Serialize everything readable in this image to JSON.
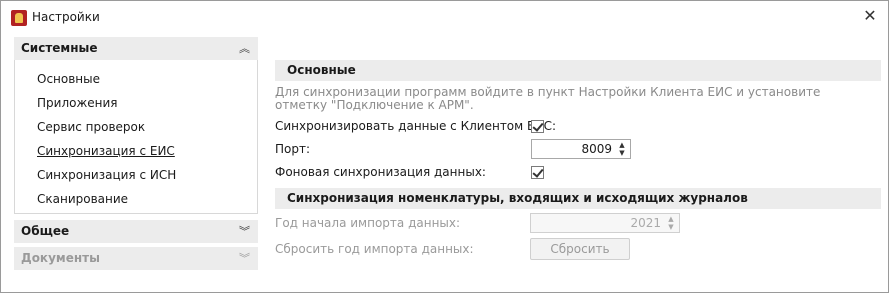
{
  "window": {
    "title": "Настройки",
    "close_symbol": "✕"
  },
  "sidebar": {
    "groups": [
      {
        "label": "Системные",
        "expanded": true,
        "chevron": "︽",
        "items": [
          {
            "label": "Основные"
          },
          {
            "label": "Приложения"
          },
          {
            "label": "Сервис проверок"
          },
          {
            "label": "Синхронизация с ЕИС",
            "active": true
          },
          {
            "label": "Синхронизация с ИСН"
          },
          {
            "label": "Сканирование"
          }
        ]
      },
      {
        "label": "Общее",
        "expanded": false,
        "chevron": "︾"
      },
      {
        "label": "Документы",
        "expanded": false,
        "disabled": true,
        "chevron": "︾"
      }
    ]
  },
  "main": {
    "section1": {
      "title": "Основные",
      "note": "Для синхронизации программ войдите в пункт Настройки Клиента ЕИС и установите отметку \"Подключение к АРМ\".",
      "sync_label": "Синхронизировать данные с Клиентом ЕИС:",
      "sync_checked": true,
      "port_label": "Порт:",
      "port_value": "8009",
      "bg_sync_label": "Фоновая синхронизация данных:",
      "bg_sync_checked": true
    },
    "section2": {
      "title": "Синхронизация номенклатуры, входящих и исходящих журналов",
      "year_label": "Год начала импорта данных:",
      "year_value": "2021",
      "reset_label": "Сбросить год импорта данных:",
      "reset_button": "Сбросить"
    }
  },
  "colors": {
    "header_bg": "#ececec",
    "disabled_text": "#9a9a9a",
    "app_icon": "#b22222"
  },
  "icons": {
    "app": "app-logo-icon",
    "close": "close-icon",
    "collapse": "chevron-up-double-icon",
    "expand": "chevron-down-double-icon",
    "spin": "spinner-arrows-icon",
    "check": "checkmark-icon"
  }
}
